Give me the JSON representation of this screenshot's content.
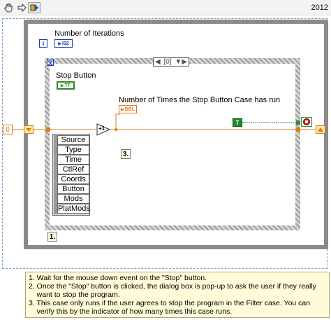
{
  "toolbar": {
    "tools": [
      {
        "name": "hand-icon"
      },
      {
        "name": "arrow-right-icon"
      },
      {
        "name": "highlight-execution-icon"
      }
    ],
    "version": "2012"
  },
  "diagram": {
    "loop_label": "Number of Iterations",
    "iteration_terminal": "i",
    "i32_type": "I32",
    "stop_button_label": "Stop Button",
    "tf_type": "TF",
    "case_selector": "[0]",
    "counter_label": "Number of Times the Stop Button Case has run",
    "dbl_type": "DBL",
    "increment": "+1",
    "init_constant": "0",
    "true_constant": "T",
    "event_data_items": [
      "Source",
      "Type",
      "Time",
      "CtlRef",
      "Coords",
      "Button",
      "Mods",
      "PlatMods"
    ],
    "case_note": "3.",
    "loop_note": "1."
  },
  "comment": {
    "lines": [
      "1. Wait for the mouse down event on the \"Stop\" button.",
      "2. Once the \"Stop\" button is clicked, the dialog box is pop-up to ask the user if they really",
      "    want to stop the program.",
      "3. This case only runs if the user agrees to stop the program in the Filter case. You can",
      "    verify this by the indicator of how many times this case runs."
    ]
  },
  "colors": {
    "wire_numeric": "#e07a10",
    "wire_boolean": "#2c8a2c",
    "loop_border": "#8a8a8a",
    "comment_bg": "#fffbd8"
  }
}
